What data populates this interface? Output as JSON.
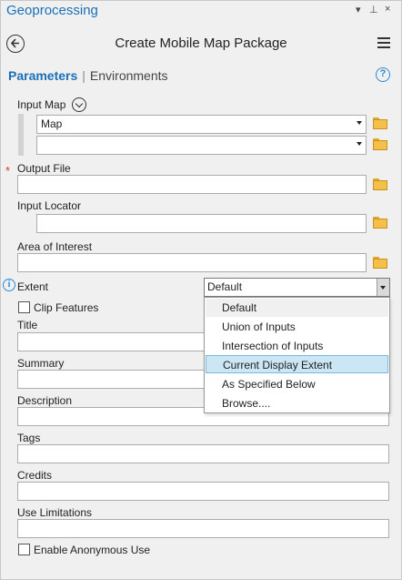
{
  "pane": {
    "title": "Geoprocessing",
    "controls": [
      "▾",
      "⊥",
      "×"
    ]
  },
  "tool": {
    "title": "Create Mobile Map Package"
  },
  "tabs": {
    "parameters": "Parameters",
    "environments": "Environments"
  },
  "params": {
    "input_map": {
      "label": "Input Map",
      "rows": [
        "Map",
        ""
      ]
    },
    "output_file": {
      "label": "Output File",
      "value": ""
    },
    "input_locator": {
      "label": "Input Locator",
      "value": ""
    },
    "area_of_interest": {
      "label": "Area of Interest",
      "value": ""
    },
    "extent": {
      "label": "Extent",
      "value": "Default",
      "options": [
        "Default",
        "Union of Inputs",
        "Intersection of Inputs",
        "Current Display Extent",
        "As Specified Below",
        "Browse...."
      ],
      "highlighted_option": "Current Display Extent"
    },
    "clip_features": {
      "label": "Clip Features",
      "checked": false
    },
    "title": {
      "label": "Title",
      "value": ""
    },
    "summary": {
      "label": "Summary",
      "value": ""
    },
    "description": {
      "label": "Description",
      "value": ""
    },
    "tags": {
      "label": "Tags",
      "value": ""
    },
    "credits": {
      "label": "Credits",
      "value": ""
    },
    "use_limitations": {
      "label": "Use Limitations",
      "value": ""
    },
    "enable_anonymous_use": {
      "label": "Enable Anonymous Use",
      "checked": false
    }
  },
  "colors": {
    "accent": "#1a70b8",
    "required": "#d04020",
    "selected": "#cbe6f5"
  },
  "icons": {
    "back": "back-arrow-icon",
    "menu": "hamburger-menu-icon",
    "help": "help-icon",
    "expand": "chevron-down-icon",
    "folder": "folder-icon",
    "info": "info-icon"
  }
}
